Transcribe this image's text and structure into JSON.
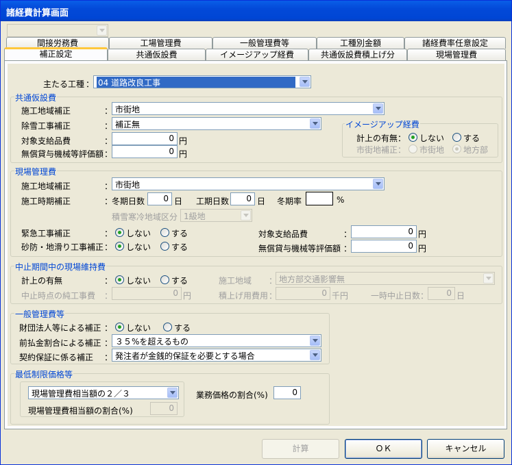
{
  "window": {
    "title": "諸経費計算画面"
  },
  "top_combo": {
    "value": ""
  },
  "tabs_row1": [
    "間接労務費",
    "工場管理費",
    "一般管理費等",
    "工種別金額",
    "諸経費率任意設定"
  ],
  "tabs_row2": [
    "補正設定",
    "共通仮設費",
    "イメージアップ経費",
    "共通仮設費積上げ分",
    "現場管理費"
  ],
  "main": {
    "label": "主たる工種",
    "value": "04 道路改良工事"
  },
  "kyotsu": {
    "title": "共通仮設費",
    "area_label": "施工地域補正",
    "area_value": "市街地",
    "snow_label": "除雪工事補正",
    "snow_value": "補正無",
    "supply_label": "対象支給品費",
    "supply_value": "0",
    "loan_label": "無償貸与機械等評価額",
    "loan_value": "0",
    "unit": "円"
  },
  "image_up": {
    "title": "イメージアップ経費",
    "count_label": "計上の有無：",
    "no": "しない",
    "yes": "する",
    "city_label": "市街地補正：",
    "city": "市街地",
    "rural": "地方部"
  },
  "genba": {
    "title": "現場管理費",
    "area_label": "施工地域補正",
    "area_value": "市街地",
    "period_label": "施工時期補正",
    "winter_days_label": "冬期日数",
    "winter_days": "0",
    "day_unit": "日",
    "work_days_label": "工期日数",
    "work_days": "0",
    "winter_rate_label": "冬期率",
    "winter_rate": "",
    "pct": "%",
    "cold_label": "積雪寒冷地域区分",
    "cold_value": "1級地",
    "urgent_label": "緊急工事補正",
    "sabo_label": "砂防・地滑り工事補正",
    "no": "しない",
    "yes": "する",
    "supply_label": "対象支給品費",
    "supply_value": "0",
    "loan_label": "無償貸与機械等評価額",
    "loan_value": "0",
    "unit": "円"
  },
  "chushi": {
    "title": "中止期間中の現場維持費",
    "count_label": "計上の有無",
    "no": "しない",
    "yes": "する",
    "area_label": "施工地域",
    "area_value": "地方部交通影響無",
    "net_label": "中止時点の純工事費",
    "net_value": "0",
    "unit_yen": "円",
    "stack_label": "積上げ用費用",
    "stack_value": "0",
    "unit_kyen": "千円",
    "pause_label": "一時中止日数",
    "pause_value": "0",
    "day_unit": "日"
  },
  "ippan": {
    "title": "一般管理費等",
    "zaidan_label": "財団法人等による補正",
    "no": "しない",
    "yes": "する",
    "advance_label": "前払金割合による補正",
    "advance_value": "３５%を超えるもの",
    "guarantee_label": "契約保証に係る補正",
    "guarantee_value": "発注者が金銭的保証を必要とする場合"
  },
  "saitei": {
    "title": "最低制限価格等",
    "combo_value": "現場管理費相当額の２／３",
    "ratio_label": "現場管理費相当額の割合(%)",
    "ratio_value": "0",
    "work_label": "業務価格の割合(%)",
    "work_value": "0"
  },
  "buttons": {
    "calc": "計算",
    "ok": "ＯＫ",
    "cancel": "キャンセル"
  },
  "colon": "："
}
